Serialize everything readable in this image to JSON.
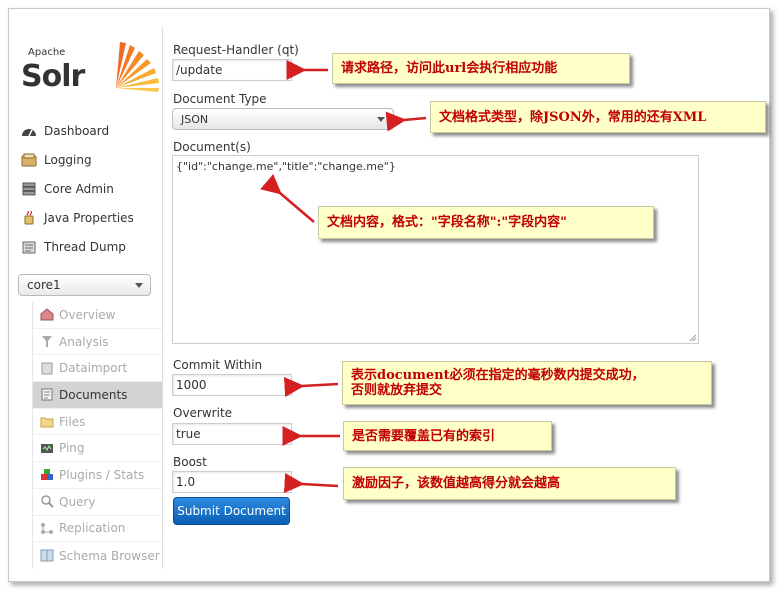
{
  "logo": {
    "apache": "Apache",
    "solr": "Solr"
  },
  "nav": [
    {
      "label": "Dashboard",
      "icon": "dashboard-icon"
    },
    {
      "label": "Logging",
      "icon": "logging-icon"
    },
    {
      "label": "Core Admin",
      "icon": "core-admin-icon"
    },
    {
      "label": "Java Properties",
      "icon": "java-properties-icon"
    },
    {
      "label": "Thread Dump",
      "icon": "thread-dump-icon"
    }
  ],
  "core_selector": {
    "value": "core1"
  },
  "core_menu": [
    {
      "label": "Overview",
      "icon": "overview-icon"
    },
    {
      "label": "Analysis",
      "icon": "analysis-icon"
    },
    {
      "label": "Dataimport",
      "icon": "dataimport-icon"
    },
    {
      "label": "Documents",
      "icon": "documents-icon",
      "active": true
    },
    {
      "label": "Files",
      "icon": "files-icon"
    },
    {
      "label": "Ping",
      "icon": "ping-icon"
    },
    {
      "label": "Plugins / Stats",
      "icon": "plugins-icon"
    },
    {
      "label": "Query",
      "icon": "query-icon"
    },
    {
      "label": "Replication",
      "icon": "replication-icon"
    },
    {
      "label": "Schema Browser",
      "icon": "schema-browser-icon"
    }
  ],
  "form": {
    "request_handler_label": "Request-Handler (qt)",
    "request_handler_value": "/update",
    "doc_type_label": "Document Type",
    "doc_type_value": "JSON",
    "documents_label": "Document(s)",
    "documents_value": "{\"id\":\"change.me\",\"title\":\"change.me\"}",
    "commit_within_label": "Commit Within",
    "commit_within_value": "1000",
    "overwrite_label": "Overwrite",
    "overwrite_value": "true",
    "boost_label": "Boost",
    "boost_value": "1.0",
    "submit_label": "Submit Document"
  },
  "annotations": {
    "request_handler": "请求路径，访问此url会执行相应功能",
    "doc_type": "文档格式类型，除JSON外，常用的还有XML",
    "documents": "文档内容，格式：\"字段名称\":\"字段内容\"",
    "commit_within_line1": "表示document必须在指定的毫秒数内提交成功，",
    "commit_within_line2": "否则就放弃提交",
    "overwrite": "是否需要覆盖已有的索引",
    "boost": "激励因子，该数值越高得分就会越高"
  },
  "colors": {
    "annotation_text": "#c00000",
    "annotation_bg": "#ffffc8",
    "arrow": "#d42020",
    "submit_button": "#1a72c9"
  }
}
